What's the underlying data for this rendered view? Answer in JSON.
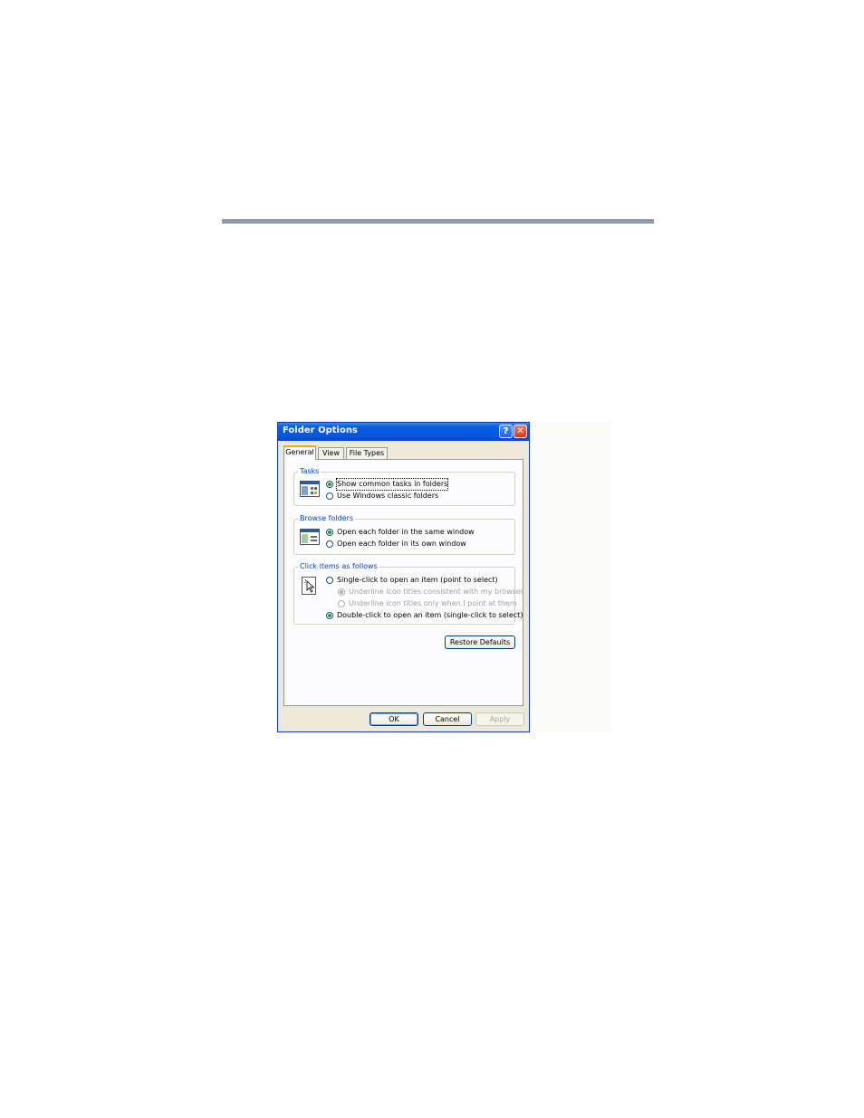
{
  "dialog": {
    "title": "Folder Options",
    "help_glyph": "?",
    "close_glyph": "✕",
    "tabs": [
      {
        "label": "General",
        "active": true
      },
      {
        "label": "View",
        "active": false
      },
      {
        "label": "File Types",
        "active": false
      }
    ],
    "groups": {
      "tasks": {
        "label": "Tasks",
        "icon": "folder-tasks-icon",
        "options": [
          {
            "label": "Show common tasks in folders",
            "checked": true
          },
          {
            "label": "Use Windows classic folders",
            "checked": false
          }
        ]
      },
      "browse": {
        "label": "Browse folders",
        "icon": "browse-window-icon",
        "options": [
          {
            "label": "Open each folder in the same window",
            "checked": true
          },
          {
            "label": "Open each folder in its own window",
            "checked": false
          }
        ]
      },
      "click": {
        "label": "Click items as follows",
        "icon": "pointer-click-icon",
        "options": [
          {
            "label": "Single-click to open an item (point to select)",
            "checked": false
          },
          {
            "label": "Underline icon titles consistent with my browser",
            "checked": true,
            "disabled": true
          },
          {
            "label": "Underline icon titles only when I point at them",
            "checked": false,
            "disabled": true
          },
          {
            "label": "Double-click to open an item (single-click to select)",
            "checked": true
          }
        ]
      }
    },
    "buttons": {
      "restore_defaults": "Restore Defaults",
      "ok": "OK",
      "cancel": "Cancel",
      "apply": "Apply"
    },
    "colors": {
      "titlebar": "#0556e0",
      "group_label": "#0046d5",
      "radio_dot": "#21a121",
      "tab_highlight": "#f5a623",
      "page_rule": "#8e9aab"
    }
  }
}
